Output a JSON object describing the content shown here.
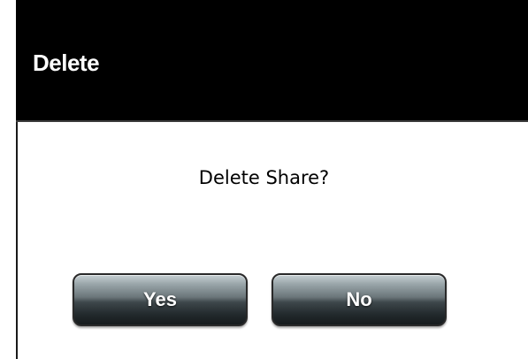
{
  "dialog": {
    "title": "Delete",
    "message": "Delete Share?",
    "buttons": {
      "yes_label": "Yes",
      "no_label": "No"
    }
  },
  "colors": {
    "title_bar_background": "#000000",
    "title_text": "#ffffff",
    "body_background": "#ffffff",
    "button_text": "#ffffff"
  }
}
